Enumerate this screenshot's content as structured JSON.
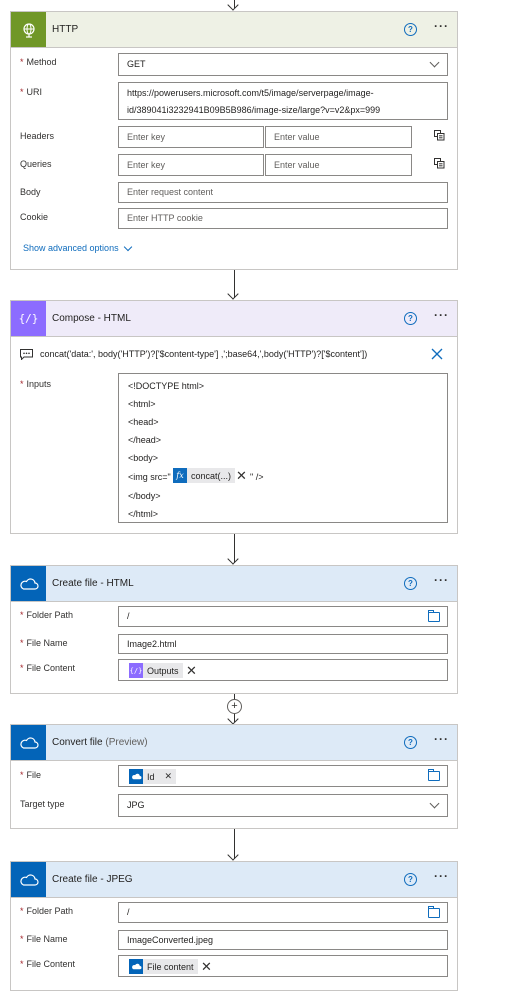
{
  "http": {
    "title": "HTTP",
    "method_label": "Method",
    "method_value": "GET",
    "uri_label": "URI",
    "uri_line1": "https://powerusers.microsoft.com/t5/image/serverpage/image-",
    "uri_line2": "id/389041i3232941B09B5B986/image-size/large?v=v2&px=999",
    "headers_label": "Headers",
    "queries_label": "Queries",
    "body_label": "Body",
    "cookie_label": "Cookie",
    "enter_key": "Enter key",
    "enter_value": "Enter value",
    "body_placeholder": "Enter request content",
    "cookie_placeholder": "Enter HTTP cookie",
    "advanced": "Show advanced options"
  },
  "compose": {
    "title": "Compose - HTML",
    "expression": "concat('data:', body('HTTP')?['$content-type'] ,';base64,',body('HTTP')?['$content'])",
    "inputs_label": "Inputs",
    "lines": [
      "<!DOCTYPE html>",
      "<html>",
      "<head>",
      "</head>",
      "<body>"
    ],
    "img_prefix": "<img src=\"",
    "fx_token": "concat(...)",
    "img_suffix": "\" />",
    "lines_after": [
      "</body>",
      "</html>"
    ]
  },
  "create_html": {
    "title": "Create file - HTML",
    "folder_label": "Folder Path",
    "folder_value": "/",
    "name_label": "File Name",
    "name_value": "Image2.html",
    "content_label": "File Content",
    "content_token": "Outputs"
  },
  "convert": {
    "title": "Convert file",
    "preview": "(Preview)",
    "file_label": "File",
    "file_token": "Id",
    "target_label": "Target type",
    "target_value": "JPG"
  },
  "create_jpeg": {
    "title": "Create file - JPEG",
    "folder_label": "Folder Path",
    "folder_value": "/",
    "name_label": "File Name",
    "name_value": "ImageConverted.jpeg",
    "content_label": "File Content",
    "content_token": "File content"
  },
  "help_glyph": "?",
  "more_glyph": "···",
  "req_mark": "*",
  "colors": {
    "http_header": "#eef1e5",
    "http_icon": "#709727",
    "compose_header": "#efebf9",
    "compose_icon": "#8c6cff",
    "onedrive_header": "#ddeaf7",
    "onedrive_icon": "#0364b8",
    "link": "#0f6cbd"
  },
  "icons": {
    "http": "globe-icon",
    "compose": "curly-braces-icon",
    "onedrive": "cloud-icon",
    "help": "help-circle-icon",
    "more": "more-ellipsis-icon"
  }
}
